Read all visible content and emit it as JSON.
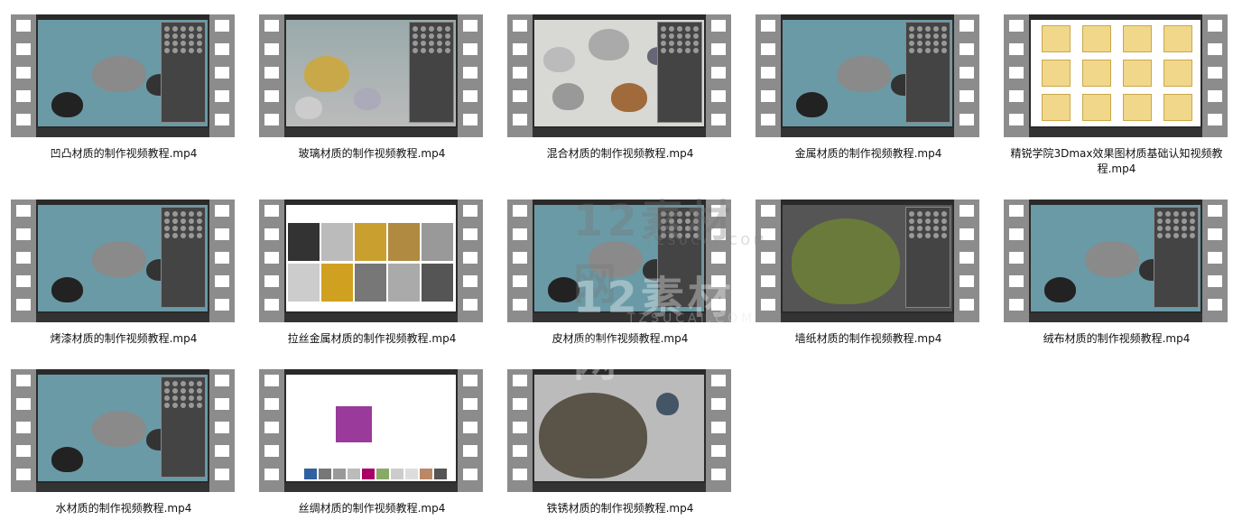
{
  "files": [
    {
      "name": "凹凸材质的制作视频教程.mp4",
      "theme": "teal"
    },
    {
      "name": "玻璃材质的制作视频教程.mp4",
      "theme": "gold"
    },
    {
      "name": "混合材质的制作视频教程.mp4",
      "theme": "gray"
    },
    {
      "name": "金属材质的制作视频教程.mp4",
      "theme": "teal"
    },
    {
      "name": "精锐学院3Dmax效果图材质基础认知视频教程.mp4",
      "theme": "folders"
    },
    {
      "name": "烤漆材质的制作视频教程.mp4",
      "theme": "teal"
    },
    {
      "name": "拉丝金属材质的制作视频教程.mp4",
      "theme": "web"
    },
    {
      "name": "皮材质的制作视频教程.mp4",
      "theme": "teal"
    },
    {
      "name": "墙纸材质的制作视频教程.mp4",
      "theme": "moss"
    },
    {
      "name": "绒布材质的制作视频教程.mp4",
      "theme": "teal"
    },
    {
      "name": "水材质的制作视频教程.mp4",
      "theme": "teal"
    },
    {
      "name": "丝绸材质的制作视频教程.mp4",
      "theme": "webpurple"
    },
    {
      "name": "铁锈材质的制作视频教程.mp4",
      "theme": "rust"
    }
  ],
  "watermark": {
    "logo": "12素材网",
    "site": "TZSUCAI.COM"
  },
  "colors": {
    "film": "#8c8c8c",
    "frame": "#2a2a2a",
    "viewport": "#6a9aa6"
  }
}
